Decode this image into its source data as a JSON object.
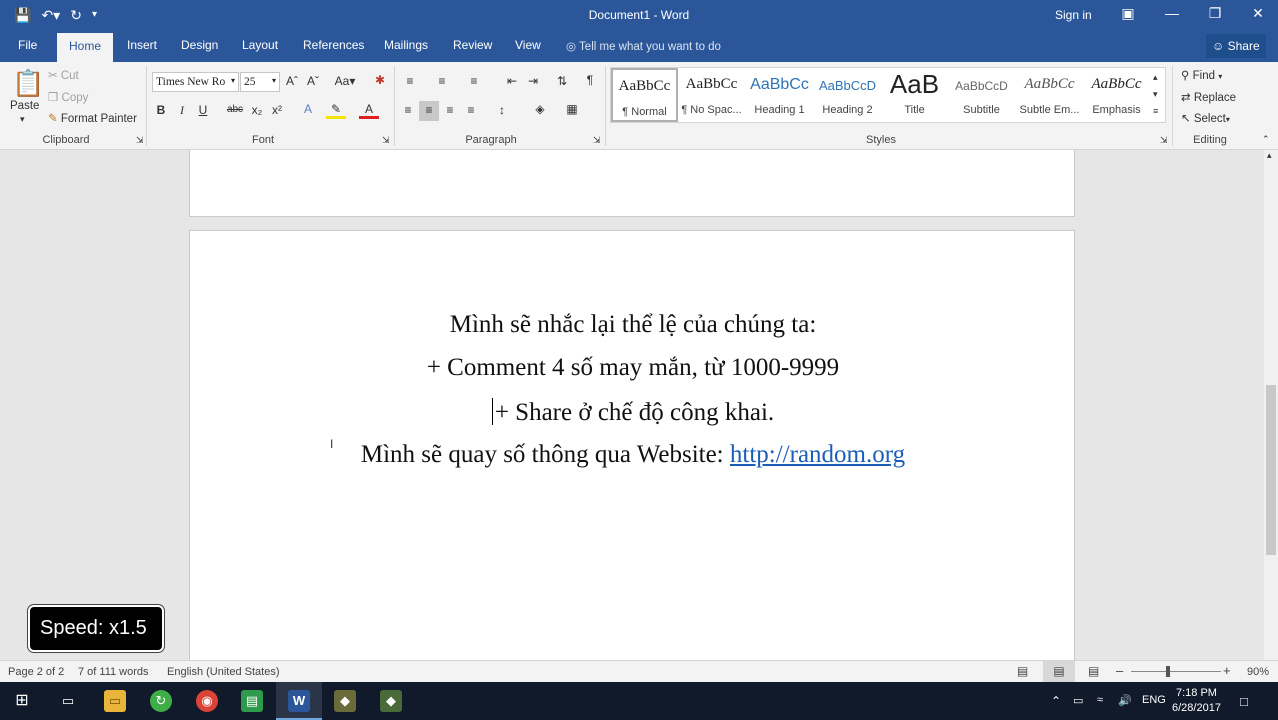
{
  "title_bar": {
    "doc_title": "Document1 - Word",
    "sign_in": "Sign in"
  },
  "tabs": [
    "File",
    "Home",
    "Insert",
    "Design",
    "Layout",
    "References",
    "Mailings",
    "Review",
    "View"
  ],
  "active_tab": "Home",
  "tell_me": "Tell me what you want to do",
  "share": "Share",
  "clipboard": {
    "paste": "Paste",
    "cut": "Cut",
    "copy": "Copy",
    "format_painter": "Format Painter",
    "label": "Clipboard"
  },
  "font": {
    "name": "Times New Ro",
    "size": "25",
    "change_case": "Aa",
    "label": "Font"
  },
  "paragraph": {
    "label": "Paragraph"
  },
  "styles": {
    "label": "Styles",
    "items": [
      {
        "preview": "AaBbCc",
        "name": "¶ Normal"
      },
      {
        "preview": "AaBbCc",
        "name": "¶ No Spac..."
      },
      {
        "preview": "AaBbCc",
        "name": "Heading 1"
      },
      {
        "preview": "AaBbCcD",
        "name": "Heading 2"
      },
      {
        "preview": "AaB",
        "name": "Title"
      },
      {
        "preview": "AaBbCcD",
        "name": "Subtitle"
      },
      {
        "preview": "AaBbCc",
        "name": "Subtle Em..."
      },
      {
        "preview": "AaBbCc",
        "name": "Emphasis"
      }
    ],
    "selected": 0
  },
  "editing": {
    "find": "Find",
    "replace": "Replace",
    "select": "Select",
    "label": "Editing"
  },
  "document": {
    "line1": "Mình sẽ nhắc lại thể lệ của chúng ta:",
    "line2": "+ Comment 4 số may mắn, từ 1000-9999",
    "line3": "+ Share ở chế độ công khai.",
    "line4_text": "Mình sẽ quay số thông qua Website: ",
    "line4_link": "http://random.org"
  },
  "overlay": {
    "speed": "Speed: x1.5"
  },
  "status": {
    "page": "Page 2 of 2",
    "words": "7 of 111 words",
    "language": "English (United States)",
    "zoom": "90%"
  },
  "tray": {
    "lang": "ENG",
    "time": "7:18 PM",
    "date": "6/28/2017"
  },
  "colors": {
    "word_blue": "#2b579a",
    "link": "#1a5eb8",
    "taskbar": "#101a2a"
  }
}
